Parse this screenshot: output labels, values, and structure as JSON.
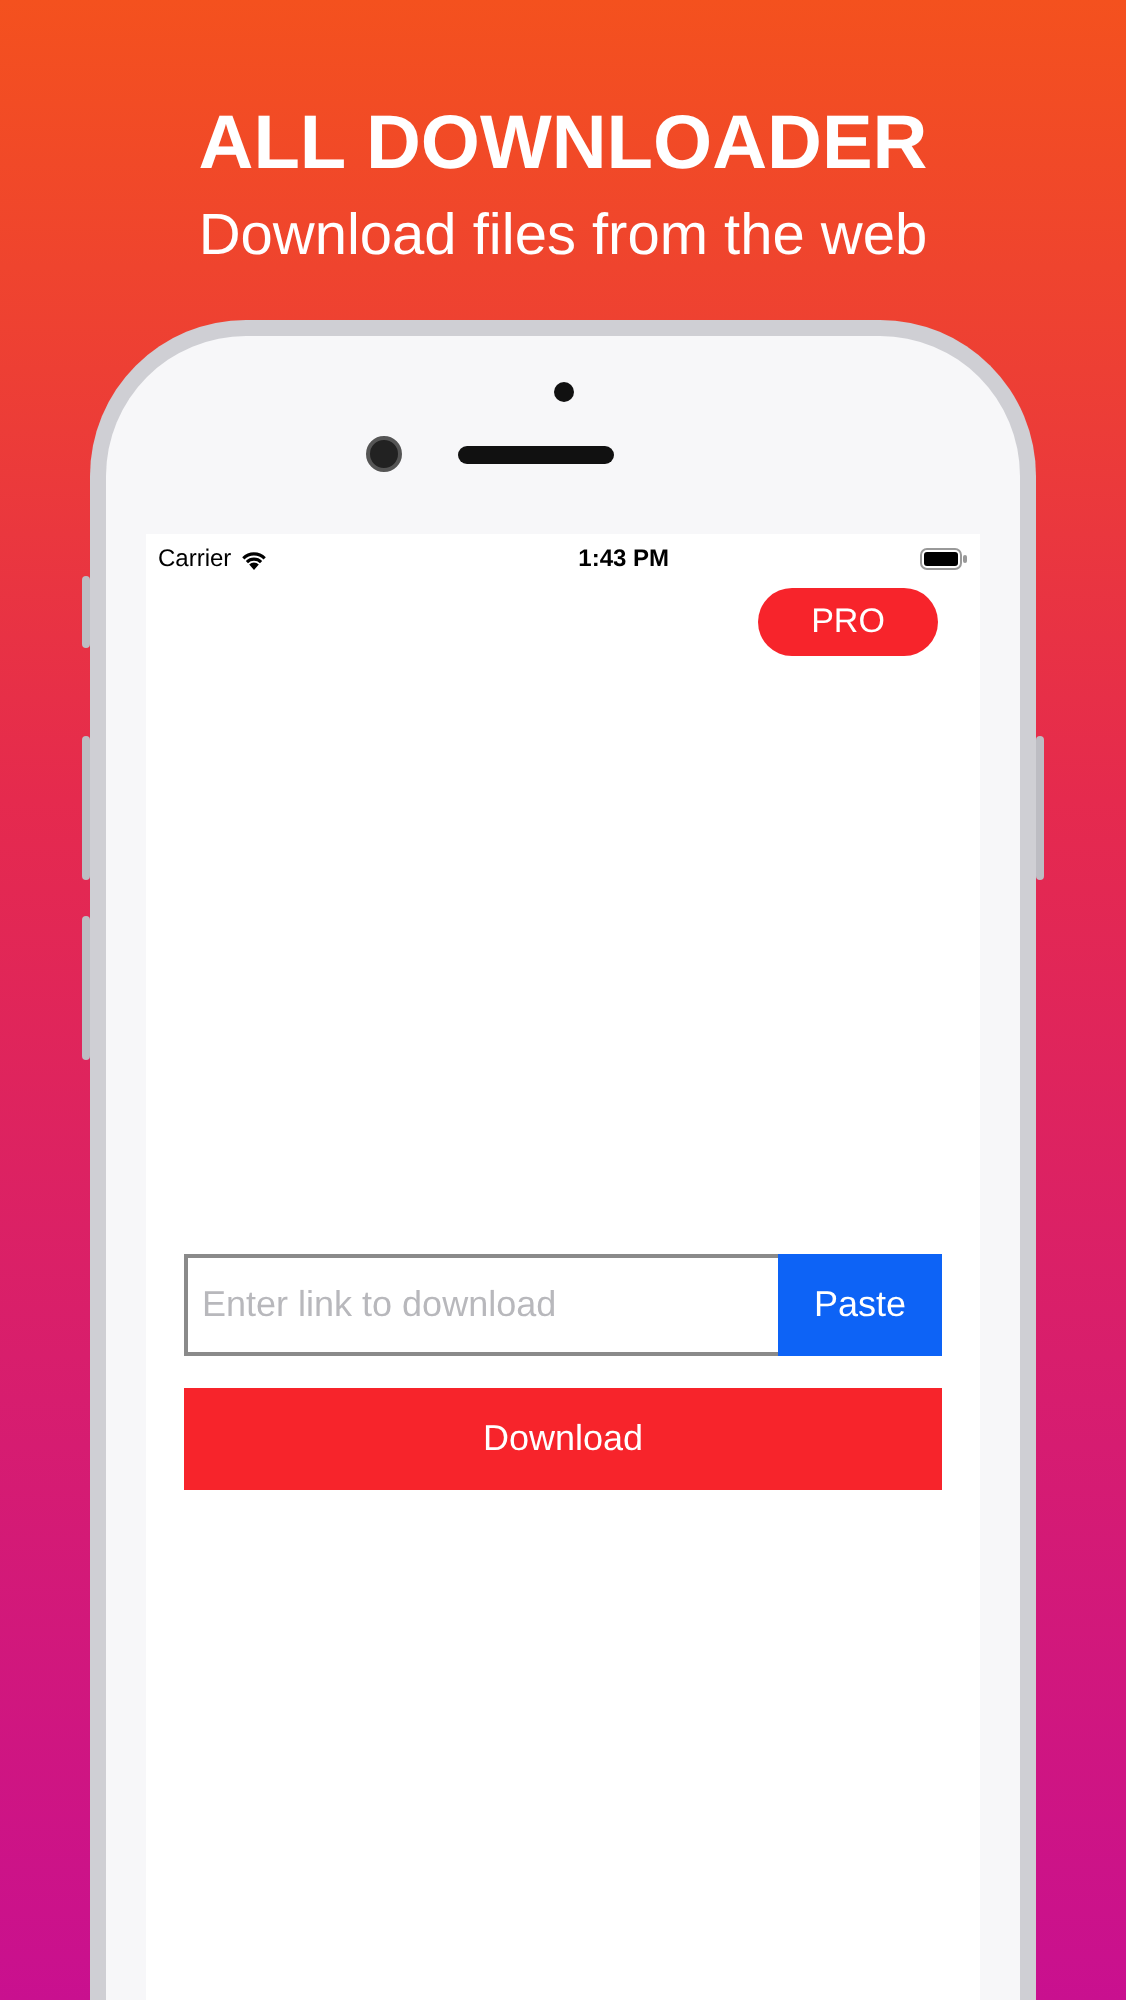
{
  "headline": {
    "title": "ALL DOWNLOADER",
    "subtitle": "Download files from the web"
  },
  "status_bar": {
    "carrier": "Carrier",
    "time": "1:43 PM"
  },
  "pro_button": "PRO",
  "link_field": {
    "placeholder": "Enter link to download"
  },
  "paste_button": "Paste",
  "download_button": "Download"
}
